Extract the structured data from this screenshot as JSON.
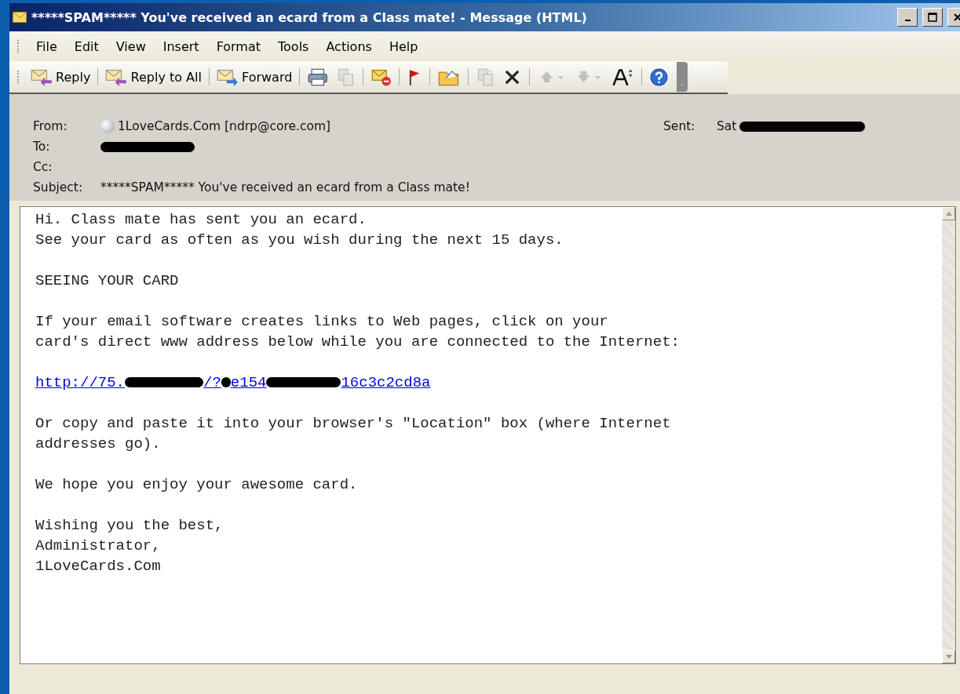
{
  "window": {
    "title": "*****SPAM***** You've received an ecard from a Class mate! - Message (HTML)"
  },
  "menu": [
    "File",
    "Edit",
    "View",
    "Insert",
    "Format",
    "Tools",
    "Actions",
    "Help"
  ],
  "toolbar": [
    {
      "kind": "button",
      "label": "Reply",
      "disabled": false
    },
    {
      "kind": "separator"
    },
    {
      "kind": "button",
      "label": "Reply to All",
      "disabled": false
    },
    {
      "kind": "separator"
    },
    {
      "kind": "button",
      "label": "Forward",
      "disabled": false
    },
    {
      "kind": "separator"
    },
    {
      "kind": "icon",
      "disabled": false
    },
    {
      "kind": "icon",
      "disabled": true
    },
    {
      "kind": "separator"
    },
    {
      "kind": "icon",
      "disabled": false
    },
    {
      "kind": "separator"
    },
    {
      "kind": "icon",
      "disabled": false
    },
    {
      "kind": "separator"
    },
    {
      "kind": "icon",
      "disabled": false
    },
    {
      "kind": "separator"
    },
    {
      "kind": "icon",
      "disabled": true
    },
    {
      "kind": "icon",
      "disabled": false
    },
    {
      "kind": "separator"
    },
    {
      "kind": "icon",
      "disabled": true
    },
    {
      "kind": "icon",
      "disabled": true
    },
    {
      "kind": "icon",
      "disabled": false
    },
    {
      "kind": "separator"
    },
    {
      "kind": "icon",
      "disabled": false
    }
  ],
  "header": {
    "from_label": "From:",
    "from": "1LoveCards.Com [ndrp@core.com]",
    "to_label": "To:",
    "to_redacted": true,
    "cc_label": "Cc:",
    "subject_label": "Subject:",
    "subject": "*****SPAM***** You've received an ecard from a Class mate!",
    "sent_label": "Sent:",
    "sent": "Sat",
    "sent_redacted": true
  },
  "body": [
    {
      "kind": "text",
      "text": "Hi. Class mate has sent you an ecard.\nSee your card as often as you wish during the next 15 days."
    },
    {
      "kind": "text",
      "text": "SEEING YOUR CARD"
    },
    {
      "kind": "text",
      "text": "If your email software creates links to Web pages, click on your\ncard's direct www address below while you are connected to the Internet:"
    },
    {
      "kind": "link",
      "parts": [
        {
          "kind": "text",
          "text": "http://75."
        },
        {
          "kind": "redacted"
        },
        {
          "kind": "text",
          "text": "/?"
        },
        {
          "kind": "redacted"
        },
        {
          "kind": "text",
          "text": "e154"
        },
        {
          "kind": "redacted"
        },
        {
          "kind": "text",
          "text": "16c3c2cd8a"
        }
      ]
    },
    {
      "kind": "text",
      "text": "Or copy and paste it into your browser's \"Location\" box (where Internet\naddresses go)."
    },
    {
      "kind": "text",
      "text": "We hope you enjoy your awesome card."
    },
    {
      "kind": "text",
      "text": "Wishing you the best,\nAdministrator,\n1LoveCards.Com"
    }
  ]
}
